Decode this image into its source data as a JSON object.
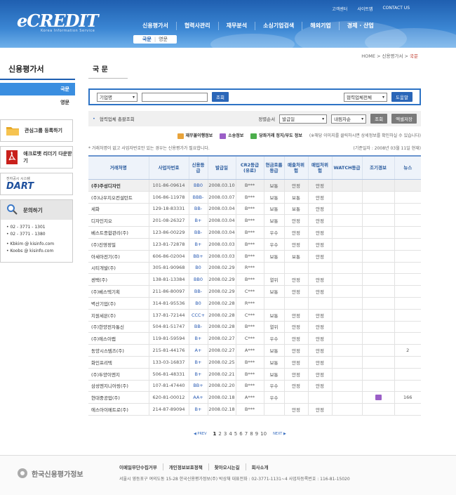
{
  "header": {
    "logo": "CREDIT",
    "logo_prefix": "e",
    "logo_sub": "Korea Information Service",
    "util": [
      "고객센터",
      "사이트맵",
      "CONTACT US"
    ],
    "gnb": [
      "신용평가서",
      "협력사관리",
      "재무분석",
      "소싱기업검색",
      "해외기업",
      "경제 · 산업"
    ],
    "subnav": [
      "국문",
      "영문"
    ]
  },
  "breadcrumb": [
    "HOME",
    "신용평가서",
    "국문"
  ],
  "sidebar": {
    "title": "신용평가서",
    "items": [
      "국문",
      "영문"
    ],
    "quick": [
      "관심그룹 등록하기",
      "애크로뱃 리더기 다운받기"
    ],
    "dart_label": "전자공시 시스템",
    "dart": "DART",
    "inquiry": "문의하기",
    "phones": [
      "02 - 3771 - 1301",
      "02 - 3771 - 1380"
    ],
    "emails": [
      "Kbkim @ kisinfo.com",
      "Koobs @ kisinfo.com"
    ]
  },
  "main": {
    "title": "국 문",
    "search": {
      "select1": "기업명",
      "btn": "조회",
      "select2": "협력업체전체",
      "help": "도움말"
    },
    "filter": {
      "label": "협력업체 총괄조회",
      "sort_label": "정렬순서",
      "sort1": "발급일",
      "sort2": "내림차순",
      "btn": "조회",
      "excel": "엑셀저장"
    },
    "legend": [
      "재무불이행정보",
      "소송정보",
      "당좌거래 정지/부도 정보",
      "(※해당 이미지를 클릭하시면 상세정보를 확인하실 수 있습니다)"
    ],
    "note": "* 거래처명이 없고 사업자번호만 있는 경우는 신용평가가 필요합니다.",
    "basis": "(기준일자 : 2008년 03월 11일 현재)",
    "columns": [
      "거래처명",
      "사업자번호",
      "신용등급",
      "발급일",
      "CR2등급(유료)",
      "현금흐름등급",
      "매출처위험",
      "매입처위험",
      "WATCH등급",
      "조기경보",
      "뉴스"
    ],
    "rows": [
      [
        "(주)주성디자인",
        "101-86-09614",
        "BB0",
        "2008.03.10",
        "B***",
        "보통",
        "안정",
        "안정",
        "",
        "",
        ""
      ],
      [
        "(주)나우지오컨설턴트",
        "106-86-11978",
        "BBB-",
        "2008.03.07",
        "B***",
        "보통",
        "보통",
        "안정",
        "",
        "",
        ""
      ],
      [
        "세화",
        "129-18-83331",
        "BB-",
        "2008.03.04",
        "B***",
        "보통",
        "보통",
        "안정",
        "",
        "",
        ""
      ],
      [
        "디자인지오",
        "201-08-26327",
        "B+",
        "2008.03.04",
        "B***",
        "보통",
        "안정",
        "안정",
        "",
        "",
        ""
      ],
      [
        "베스트종합관리(주)",
        "123-86-00229",
        "BB-",
        "2008.03.04",
        "B***",
        "우수",
        "안정",
        "안정",
        "",
        "",
        ""
      ],
      [
        "(주)진영정밀",
        "123-81-72878",
        "B+",
        "2008.03.03",
        "B***",
        "우수",
        "안정",
        "안정",
        "",
        "",
        ""
      ],
      [
        "아세아전기(주)",
        "606-86-02004",
        "BB+",
        "2008.03.03",
        "B***",
        "보통",
        "보통",
        "안정",
        "",
        "",
        ""
      ],
      [
        "시티개발(주)",
        "305-81-90968",
        "B0",
        "2008.02.29",
        "R***",
        "",
        "",
        "",
        "",
        "",
        ""
      ],
      [
        "센택(주)",
        "138-81-13384",
        "BB0",
        "2008.02.29",
        "B***",
        "열위",
        "안정",
        "안정",
        "",
        "",
        ""
      ],
      [
        "(주)베스텍기획",
        "211-86-80097",
        "BB-",
        "2008.02.29",
        "C***",
        "보통",
        "안정",
        "안정",
        "",
        "",
        ""
      ],
      [
        "벽산기업(주)",
        "314-81-95536",
        "B0",
        "2008.02.28",
        "R***",
        "",
        "",
        "",
        "",
        "",
        ""
      ],
      [
        "지원세븐(주)",
        "137-81-72144",
        "CCC+",
        "2008.02.28",
        "C***",
        "보통",
        "안정",
        "안정",
        "",
        "",
        ""
      ],
      [
        "(주)한양전자통신",
        "504-81-51747",
        "BB-",
        "2008.02.28",
        "B***",
        "열위",
        "안정",
        "안정",
        "",
        "",
        ""
      ],
      [
        "(주)에스이랩",
        "119-81-59594",
        "B+",
        "2008.02.27",
        "C***",
        "우수",
        "안정",
        "안정",
        "",
        "",
        ""
      ],
      [
        "동양시스템즈(주)",
        "215-81-44176",
        "A+",
        "2008.02.27",
        "A***",
        "보통",
        "안정",
        "안정",
        "",
        "",
        "2"
      ],
      [
        "화인프리텍",
        "133-03-16837",
        "B+",
        "2008.02.25",
        "B***",
        "보통",
        "안정",
        "안정",
        "",
        "",
        ""
      ],
      [
        "(주)두양이엔지",
        "506-81-48331",
        "B+",
        "2008.02.21",
        "B***",
        "보통",
        "안정",
        "안정",
        "",
        "",
        ""
      ],
      [
        "삼성엔지니어링(주)",
        "107-81-47440",
        "BB+",
        "2008.02.20",
        "B***",
        "우수",
        "안정",
        "안정",
        "",
        "",
        ""
      ],
      [
        "현대중공업(주)",
        "620-81-00012",
        "AA+",
        "2008.02.18",
        "A***",
        "우수",
        "",
        "",
        "",
        "news-icon",
        "166"
      ],
      [
        "에스아이메트로(주)",
        "214-87-89094",
        "B+",
        "2008.02.18",
        "B***",
        "",
        "안정",
        "안정",
        "",
        "",
        ""
      ]
    ]
  },
  "pager": {
    "prev": "◀ PREV",
    "next": "NEXT ▶",
    "pages": [
      "1",
      "2",
      "3",
      "4",
      "5",
      "6",
      "7",
      "8",
      "9",
      "10"
    ]
  },
  "footer": {
    "logo": "한국신용평가정보",
    "links": [
      "이메일무단수집거부",
      "개인정보보호정책",
      "찾아오시는길",
      "회사소개"
    ],
    "address": "서울시 영등포구 여의도동 15-28 한국신용평가정보(주) 박상채    대표전화 : 02-3771-1131~4    사업자등록번호 : 116-81-15020"
  }
}
